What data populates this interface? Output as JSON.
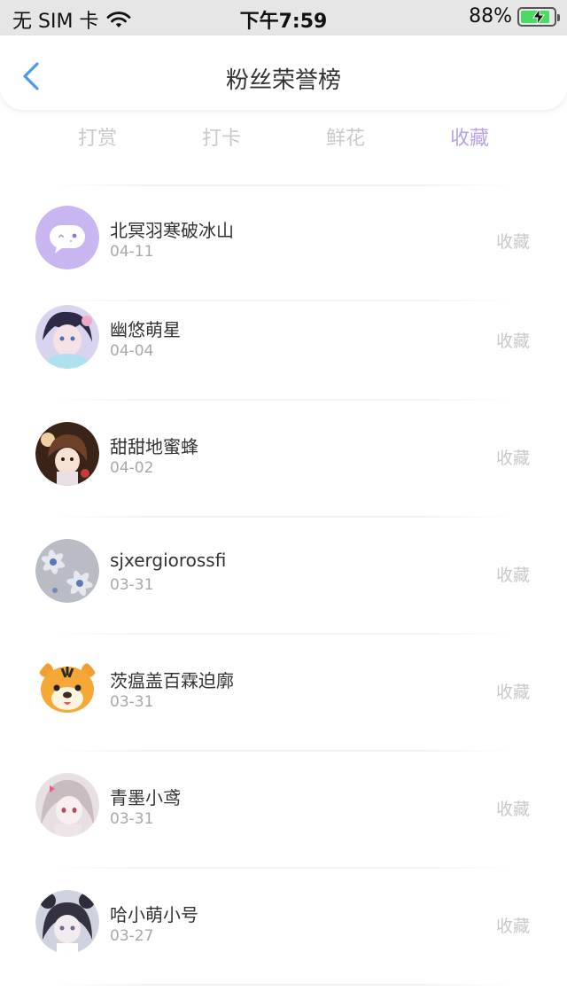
{
  "status_bar": {
    "carrier": "无 SIM 卡",
    "time": "下午7:59",
    "battery": "88%",
    "battery_level": 0.88
  },
  "nav": {
    "title": "粉丝荣誉榜"
  },
  "tabs": [
    {
      "label": "打赏",
      "active": false
    },
    {
      "label": "打卡",
      "active": false
    },
    {
      "label": "鲜花",
      "active": false
    },
    {
      "label": "收藏",
      "active": true
    }
  ],
  "colors": {
    "accent": "#b8a2e8",
    "back": "#4a9be8"
  },
  "rows": [
    {
      "name": "北冥羽寒破冰山",
      "date": "04-11",
      "action": "收藏",
      "avatar": "default-chat-avatar"
    },
    {
      "name": "幽悠萌星",
      "date": "04-04",
      "action": "收藏",
      "avatar": "anime-girl-avatar"
    },
    {
      "name": "甜甜地蜜蜂",
      "date": "04-02",
      "action": "收藏",
      "avatar": "anime-girl-avatar"
    },
    {
      "name": "sjxergiorossfi",
      "date": "03-31",
      "action": "收藏",
      "avatar": "flowers-avatar"
    },
    {
      "name": "茨瘟盖百霖迫廓",
      "date": "03-31",
      "action": "收藏",
      "avatar": "tiger-avatar"
    },
    {
      "name": "青墨小鸢",
      "date": "03-31",
      "action": "收藏",
      "avatar": "anime-girl-avatar"
    },
    {
      "name": "哈小萌小号",
      "date": "03-27",
      "action": "收藏",
      "avatar": "anime-girl-avatar"
    }
  ]
}
